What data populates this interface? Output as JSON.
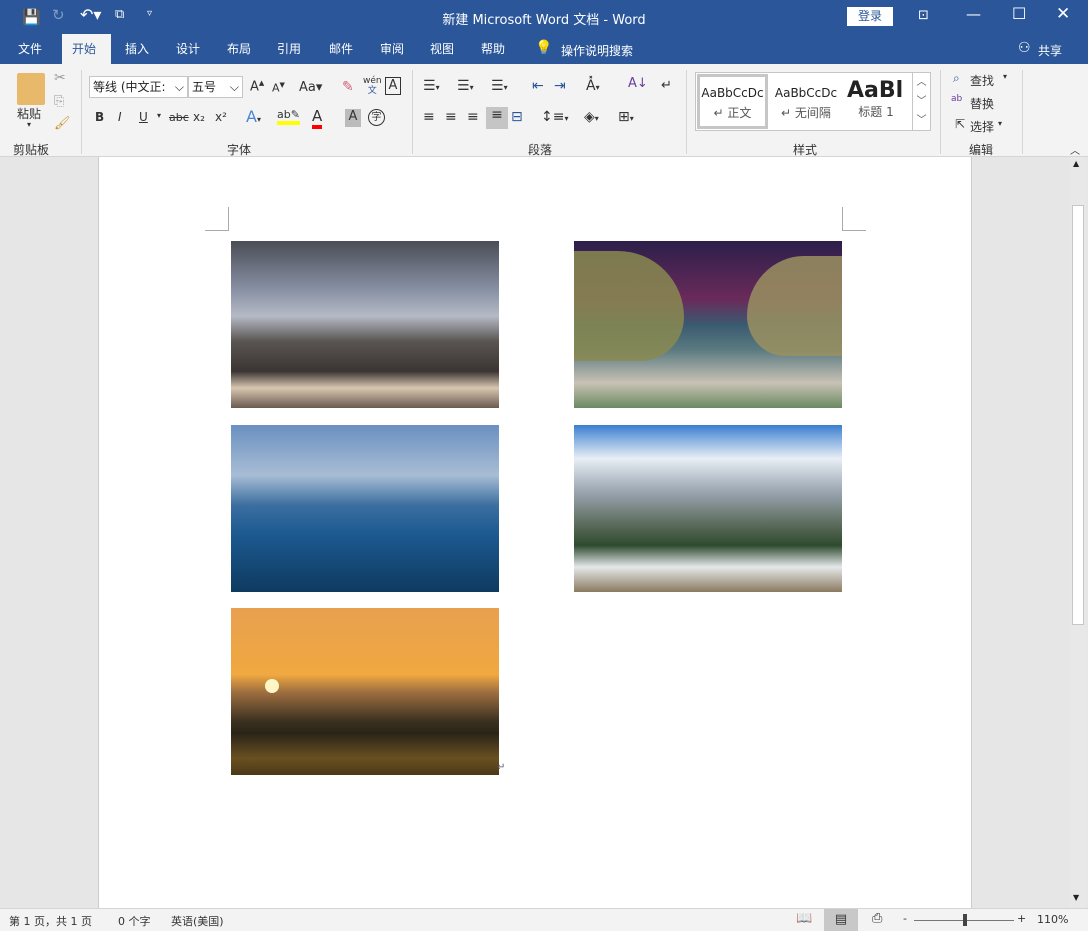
{
  "titlebar": {
    "title": "新建 Microsoft Word 文档  -  Word",
    "login": "登录",
    "qat": [
      "save-icon",
      "redo-icon",
      "undo-icon",
      "touch-mode-icon",
      "customize-icon"
    ]
  },
  "tabs": [
    {
      "label": "文件"
    },
    {
      "label": "开始",
      "active": true
    },
    {
      "label": "插入"
    },
    {
      "label": "设计"
    },
    {
      "label": "布局"
    },
    {
      "label": "引用"
    },
    {
      "label": "邮件"
    },
    {
      "label": "审阅"
    },
    {
      "label": "视图"
    },
    {
      "label": "帮助"
    }
  ],
  "search_label": "操作说明搜索",
  "share": "共享",
  "ribbon": {
    "clipboard": {
      "paste": "粘贴",
      "label": "剪贴板"
    },
    "font": {
      "name": "等线 (中文正文)",
      "name_shown": "等线 (中文正:",
      "size": "五号",
      "label": "字体",
      "wen": "wén",
      "wen2": "文",
      "case": "Aa",
      "bold": "B",
      "italic": "I",
      "underline": "U",
      "strike": "abc",
      "sub": "x₂",
      "sup": "x²",
      "colors": {
        "highlight": "#ffff00",
        "font": "#ff0000"
      }
    },
    "paragraph": {
      "label": "段落"
    },
    "styles": {
      "label": "样式",
      "items": [
        {
          "preview": "AaBbCcDc",
          "name": "正文"
        },
        {
          "preview": "AaBbCcDc",
          "name": "无间隔"
        },
        {
          "preview": "AaBl",
          "name": "标题 1"
        }
      ]
    },
    "editing": {
      "label": "编辑",
      "find": "查找",
      "replace": "替换",
      "select": "选择"
    }
  },
  "status": {
    "page": "第 1 页，共 1 页",
    "words": "0 个字",
    "lang": "英语(美国)",
    "zoom": "110%",
    "zoom_level": 110
  },
  "accent": "#2b579a",
  "images": [
    "rocky-beach-storm",
    "sea-arch-night",
    "blue-rocky-sea",
    "snowy-mountain-bridge",
    "sunset-over-water"
  ]
}
